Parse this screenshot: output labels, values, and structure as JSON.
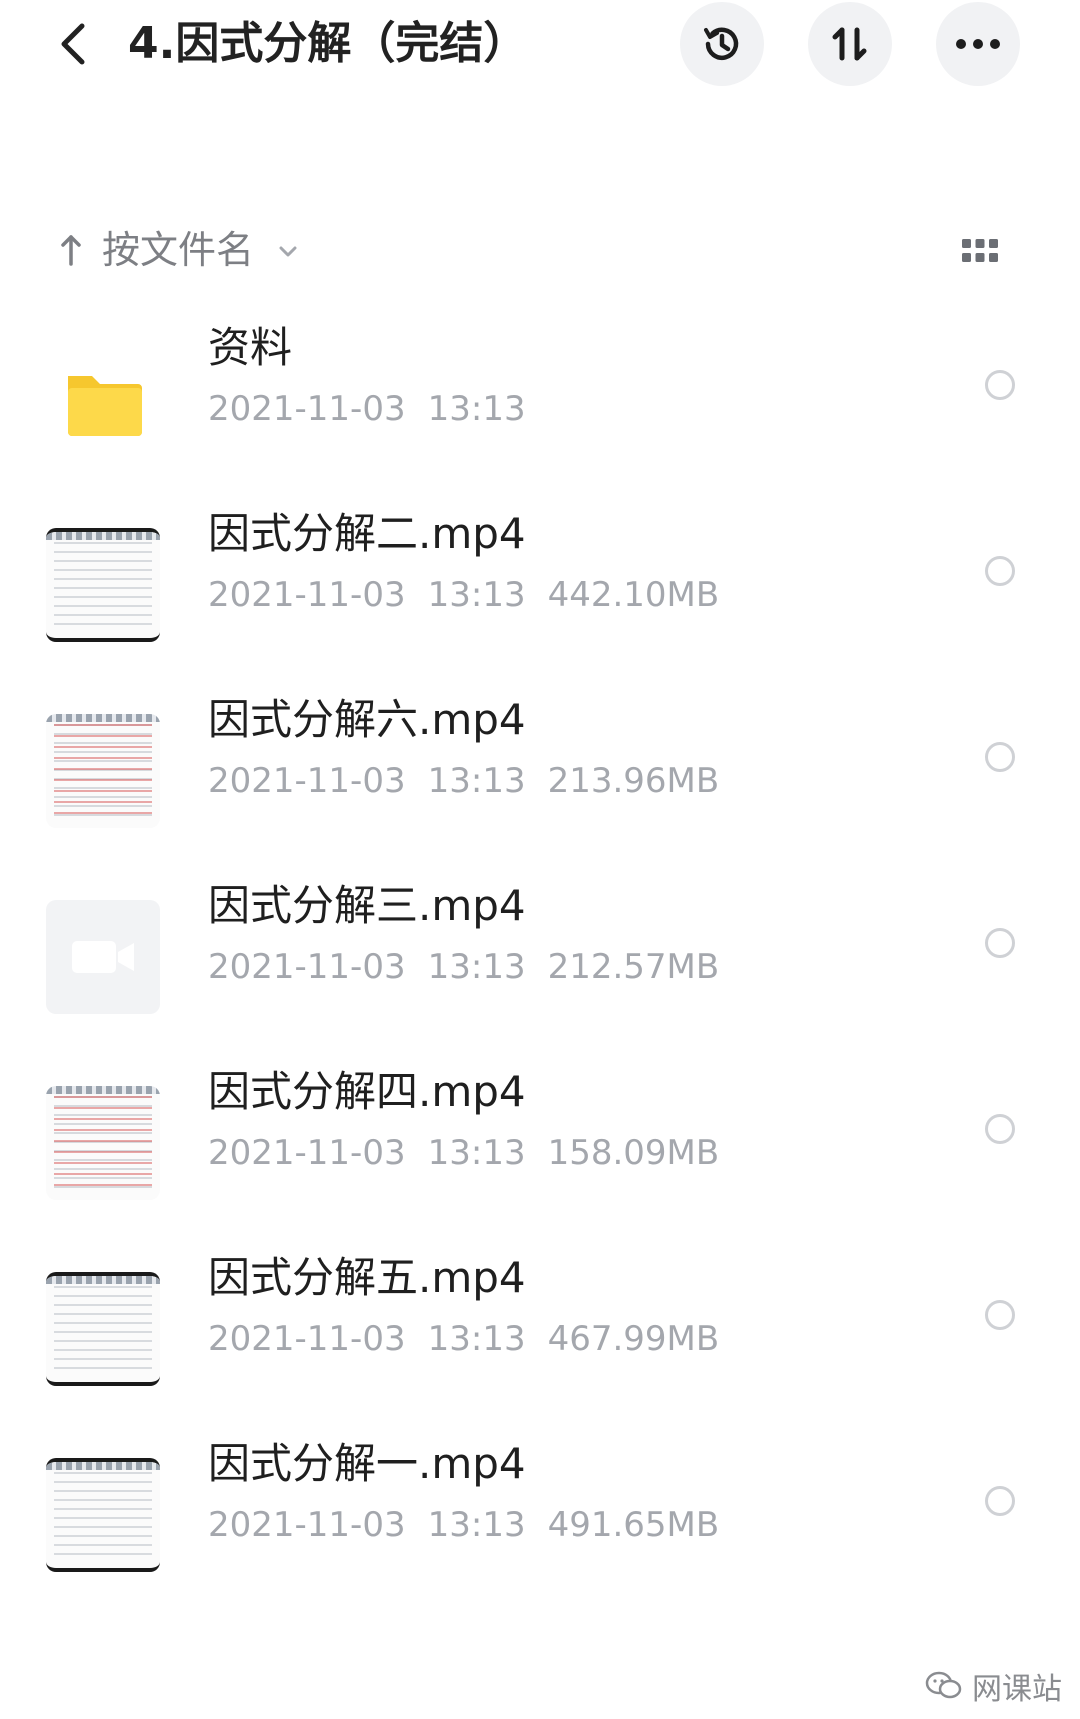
{
  "header": {
    "title": "4.因式分解（完结）",
    "back_icon": "chevron-left-icon",
    "history_icon": "history-icon",
    "sort_icon": "sort-arrows-icon",
    "more_icon": "more-dots-icon"
  },
  "sort_bar": {
    "label": "按文件名",
    "direction_icon": "arrow-up-icon",
    "dropdown_icon": "chevron-down-icon",
    "view_toggle_icon": "grid-view-icon"
  },
  "files": [
    {
      "name": "资料",
      "date": "2021-11-03",
      "time": "13:13",
      "size": "",
      "type": "folder"
    },
    {
      "name": "因式分解二.mp4",
      "date": "2021-11-03",
      "time": "13:13",
      "size": "442.10MB",
      "type": "video-doc"
    },
    {
      "name": "因式分解六.mp4",
      "date": "2021-11-03",
      "time": "13:13",
      "size": "213.96MB",
      "type": "video-doc-red"
    },
    {
      "name": "因式分解三.mp4",
      "date": "2021-11-03",
      "time": "13:13",
      "size": "212.57MB",
      "type": "video-placeholder"
    },
    {
      "name": "因式分解四.mp4",
      "date": "2021-11-03",
      "time": "13:13",
      "size": "158.09MB",
      "type": "video-doc-red"
    },
    {
      "name": "因式分解五.mp4",
      "date": "2021-11-03",
      "time": "13:13",
      "size": "467.99MB",
      "type": "video-doc"
    },
    {
      "name": "因式分解一.mp4",
      "date": "2021-11-03",
      "time": "13:13",
      "size": "491.65MB",
      "type": "video-doc"
    }
  ],
  "watermark": {
    "text": "网课站",
    "icon": "wechat-icon"
  },
  "colors": {
    "folder": "#fdd94a",
    "folder_dark": "#f6c72e",
    "meta_text": "#a4a7ad",
    "round_button_bg": "#f1f2f4"
  }
}
